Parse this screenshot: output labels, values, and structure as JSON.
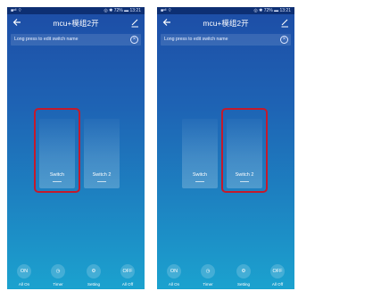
{
  "status": {
    "left": "■ᵃˡˡ ⌔",
    "right": "◎ ✱ 72% ▬ 13:21"
  },
  "header": {
    "title": "mcu+模组2开"
  },
  "hint": {
    "text": "Long press to edit switch name",
    "close": "×"
  },
  "switches": [
    "Switch",
    "Switch 2"
  ],
  "bottom": [
    {
      "icon": "ON",
      "label": "All On"
    },
    {
      "icon": "◷",
      "label": "Timer"
    },
    {
      "icon": "⚙",
      "label": "Setting"
    },
    {
      "icon": "OFF",
      "label": "All Off"
    }
  ],
  "colors": {
    "highlight": "#c41a2c",
    "bg_top": "#1d4da6",
    "bg_bottom": "#1ba2cf"
  }
}
